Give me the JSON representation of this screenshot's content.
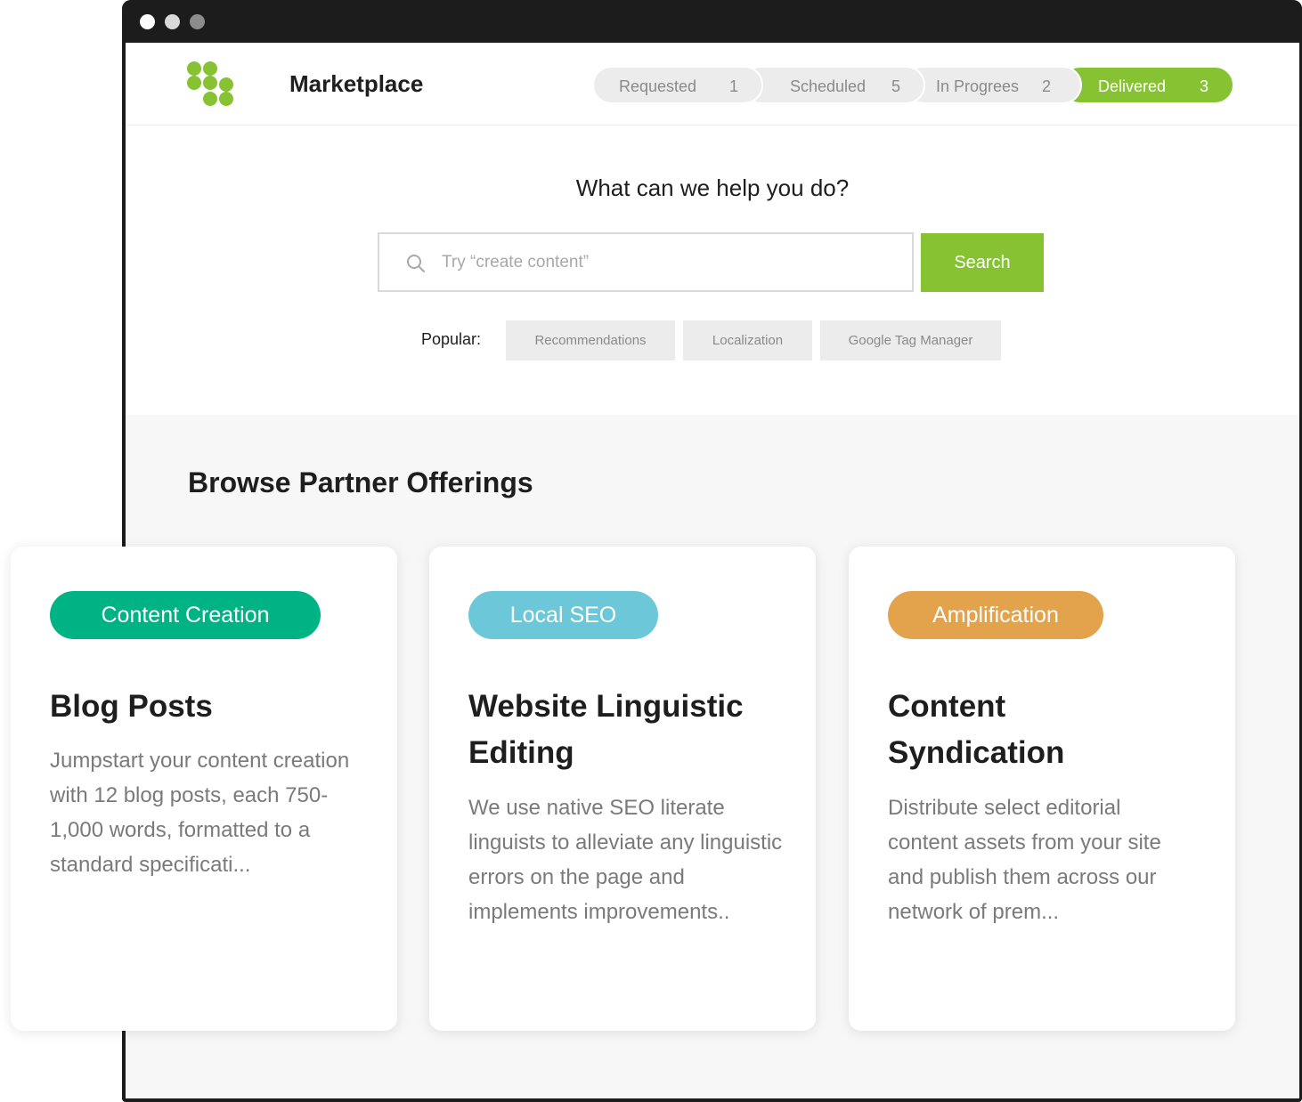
{
  "header": {
    "title": "Marketplace",
    "status_tabs": [
      {
        "label": "Requested",
        "count": "1"
      },
      {
        "label": "Scheduled",
        "count": "5"
      },
      {
        "label": "In Progrees",
        "count": "2"
      },
      {
        "label": "Delivered",
        "count": "3",
        "active": true
      }
    ]
  },
  "search": {
    "heading": "What can we help you do?",
    "placeholder": "Try “create content”",
    "button_label": "Search",
    "popular_label": "Popular:",
    "popular_chips": [
      "Recommendations",
      "Localization",
      "Google Tag Manager"
    ]
  },
  "browse": {
    "title": "Browse Partner Offerings",
    "cards": [
      {
        "tag": "Content Creation",
        "tag_color": "#00b384",
        "title": "Blog Posts",
        "description": "Jumpstart your content creation with 12 blog posts, each 750-1,000 words, formatted to a standard specificati..."
      },
      {
        "tag": "Local SEO",
        "tag_color": "#6cc8d8",
        "title": "Website Linguistic Editing",
        "description": "We use native SEO literate linguists to alleviate any linguistic errors on the page and implements improvements.."
      },
      {
        "tag": "Amplification",
        "tag_color": "#e3a24c",
        "title": "Content Syndication",
        "description": "Distribute select editorial content assets from your site and publish them across our network of prem..."
      }
    ]
  },
  "colors": {
    "brand_green": "#86c232",
    "window_frame": "#1c1c1c"
  }
}
